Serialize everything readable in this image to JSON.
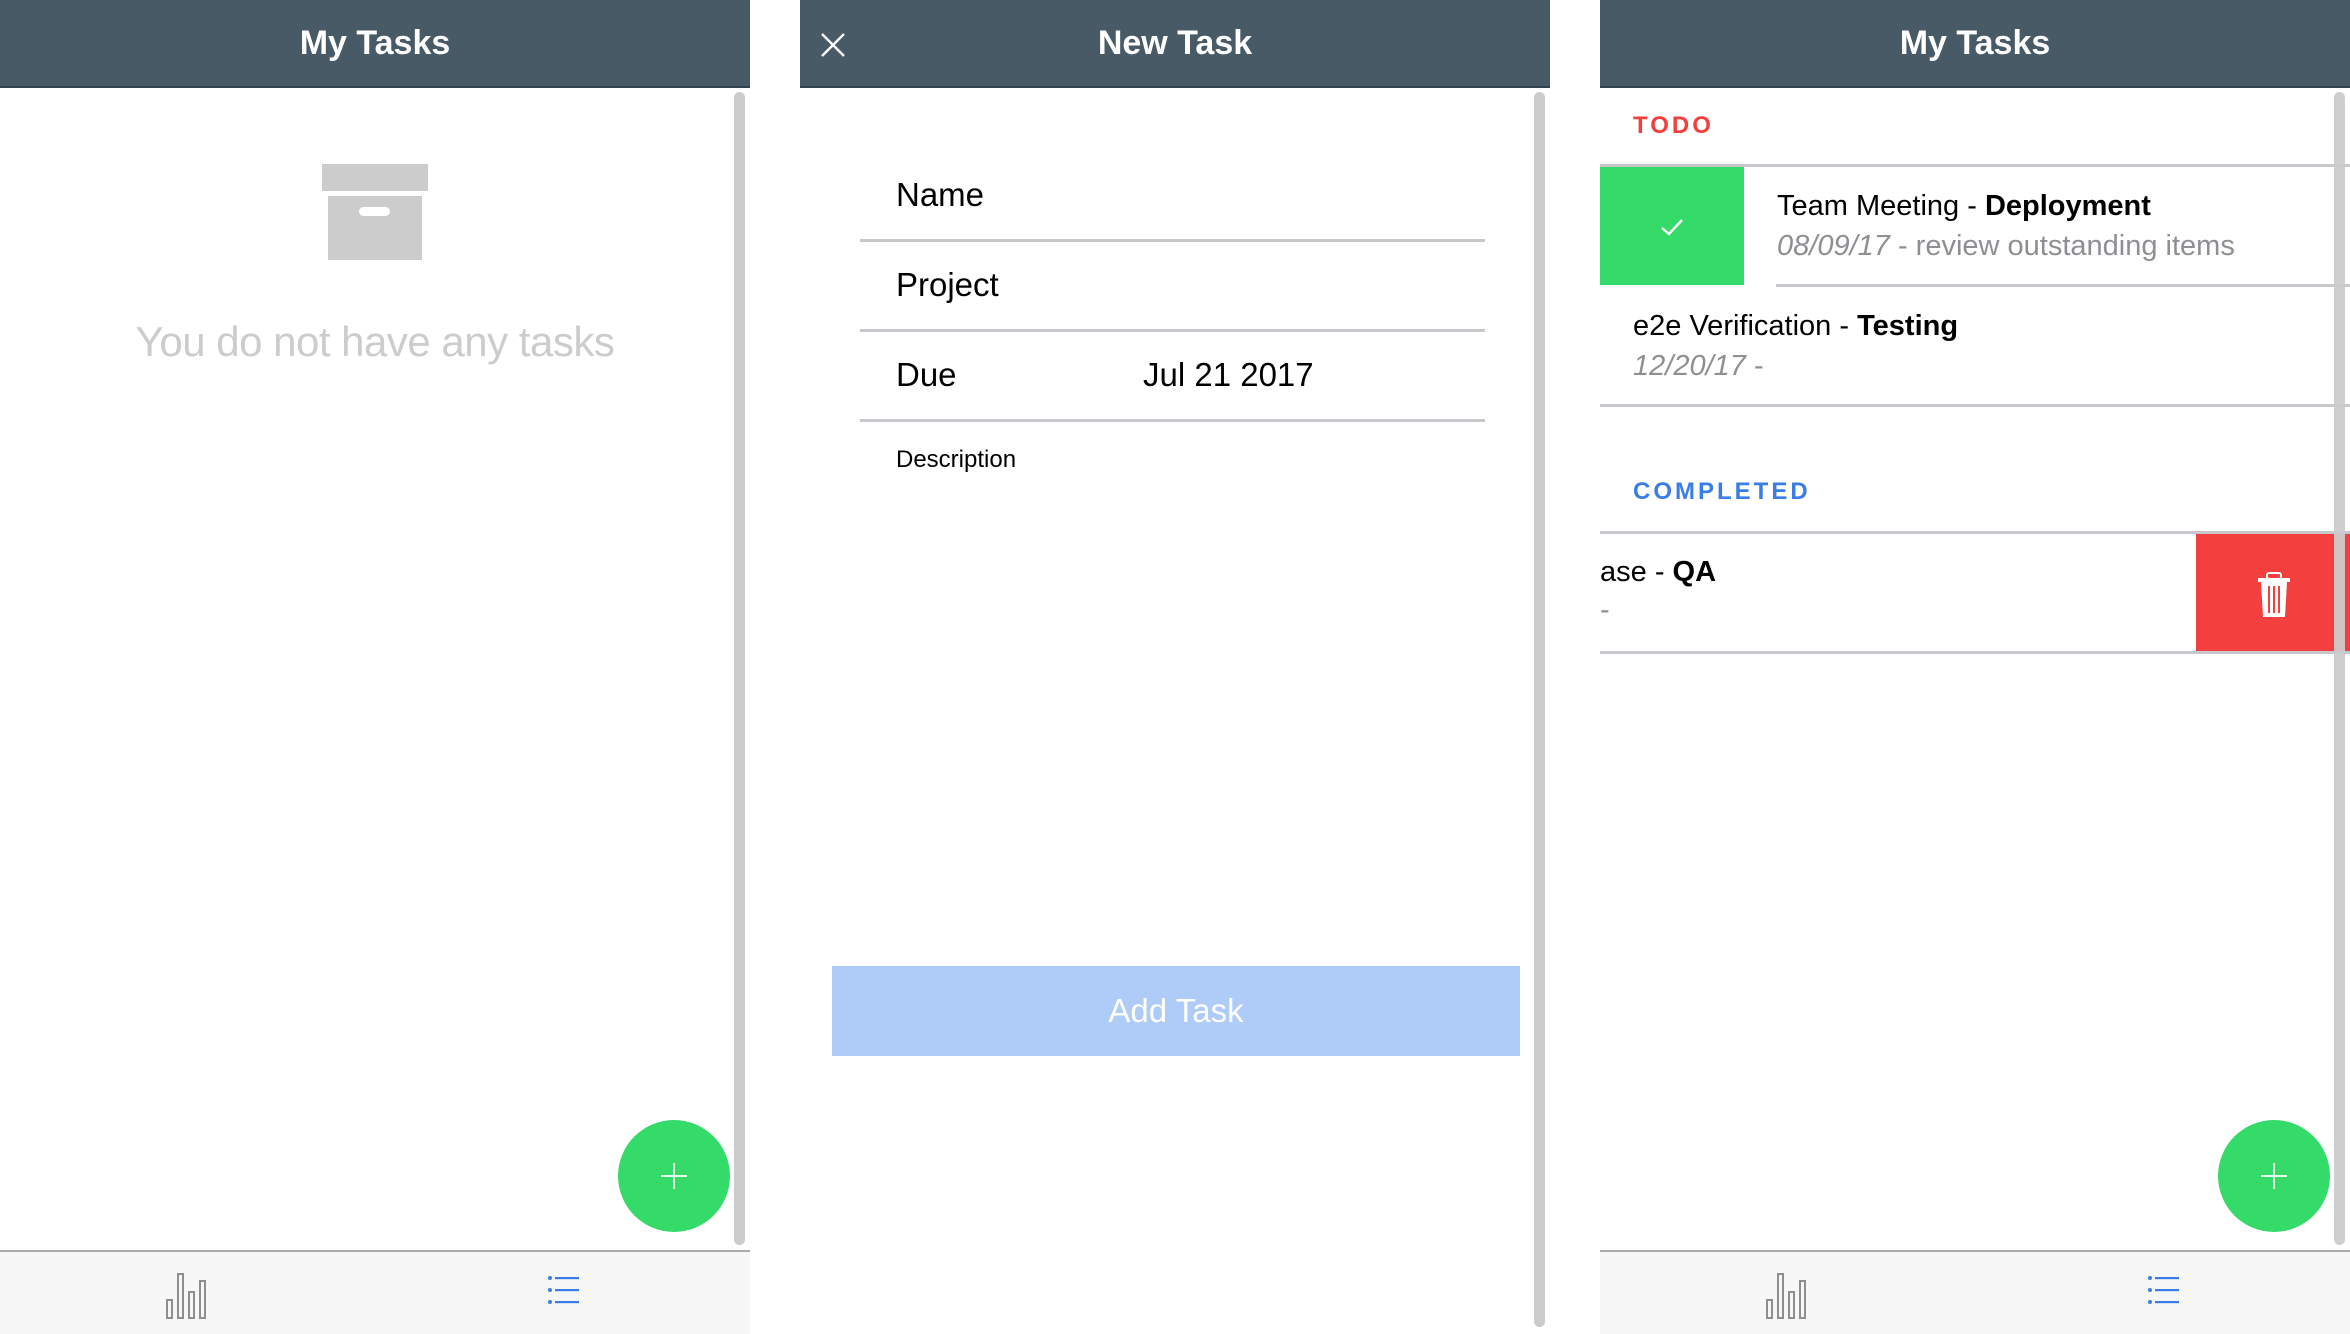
{
  "colors": {
    "header_bg": "#485a66",
    "accent_green": "#34db68",
    "accent_red": "#f43f3f",
    "accent_blue": "#3b7de8",
    "disabled_button": "#afcbf8",
    "empty_text": "#cccccc"
  },
  "screens": [
    {
      "header": {
        "title": "My Tasks"
      },
      "empty_state": {
        "icon": "archive-box-icon",
        "message": "You do not have any tasks"
      },
      "fab": {
        "icon": "plus-icon"
      },
      "tabbar": {
        "tabs": [
          {
            "name": "stats",
            "icon": "bar-chart-icon",
            "active": false
          },
          {
            "name": "tasks",
            "icon": "list-icon",
            "active": true
          }
        ]
      }
    },
    {
      "header": {
        "title": "New Task",
        "close_icon": "close-icon"
      },
      "form": {
        "fields": [
          {
            "label": "Name",
            "value": ""
          },
          {
            "label": "Project",
            "value": ""
          },
          {
            "label": "Due",
            "value": "Jul 21 2017"
          }
        ],
        "description_label": "Description",
        "description_value": "",
        "submit_label": "Add Task",
        "submit_disabled": true
      }
    },
    {
      "header": {
        "title": "My Tasks"
      },
      "sections": [
        {
          "label": "TODO",
          "items": [
            {
              "name": "Team Meeting",
              "separator": " - ",
              "project": "Deployment",
              "due": "08/09/17",
              "description": " - review outstanding items",
              "swipe_action": "complete",
              "swipe_icon": "check-icon"
            },
            {
              "name": "e2e Verification",
              "separator": " - ",
              "project": "Testing",
              "due": "12/20/17",
              "description": " -"
            }
          ]
        },
        {
          "label": "COMPLETED",
          "items": [
            {
              "name": "ase",
              "separator": " - ",
              "project": "QA",
              "due": "",
              "description": "-",
              "swipe_action": "delete",
              "swipe_icon": "trash-icon"
            }
          ]
        }
      ],
      "fab": {
        "icon": "plus-icon"
      },
      "tabbar": {
        "tabs": [
          {
            "name": "stats",
            "icon": "bar-chart-icon",
            "active": false
          },
          {
            "name": "tasks",
            "icon": "list-icon",
            "active": true
          }
        ]
      }
    }
  ]
}
